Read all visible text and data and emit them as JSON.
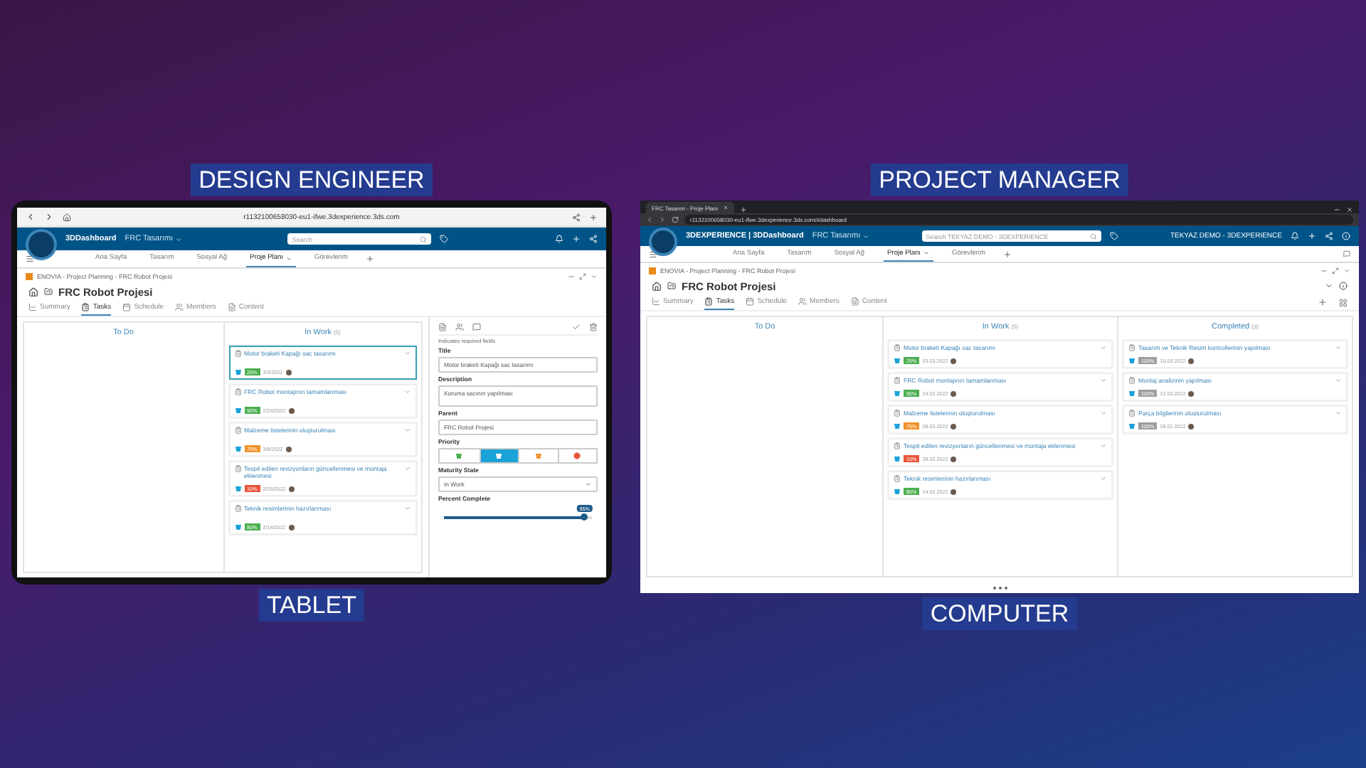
{
  "tablet": {
    "role_caption": "DESIGN ENGINEER",
    "device_caption": "TABLET",
    "url": "r1132100658030-eu1-ifwe.3dexperience.3ds.com",
    "app": {
      "brand": "3DDashboard",
      "dashboard": "FRC Tasarımı",
      "search_placeholder": "Search"
    },
    "tabs": [
      {
        "label": "Ana Sayfa",
        "selected": false
      },
      {
        "label": "Tasarım",
        "selected": false
      },
      {
        "label": "Sosyal Ağ",
        "selected": false
      },
      {
        "label": "Proje Planı",
        "selected": true
      },
      {
        "label": "Görevlerim",
        "selected": false
      }
    ],
    "breadcrumb": "ENOVIA - Project Planning - FRC Robot Projesi",
    "project": "FRC Robot Projesi",
    "views": [
      {
        "label": "Summary",
        "selected": false
      },
      {
        "label": "Tasks",
        "selected": true
      },
      {
        "label": "Schedule",
        "selected": false
      },
      {
        "label": "Members",
        "selected": false
      },
      {
        "label": "Content",
        "selected": false
      }
    ],
    "columns": [
      {
        "title": "To Do"
      },
      {
        "title": "In Work",
        "count": "(5)",
        "tasks": [
          {
            "title": "Motor braketi Kapağı sac tasarımı",
            "percent": "25%",
            "color": "#4caf50",
            "date": "3/3/2022",
            "selected": true
          },
          {
            "title": "FRC Robot montajının tamamlanması",
            "percent": "90%",
            "color": "#4caf50",
            "date": "2/24/2022",
            "selected": false
          },
          {
            "title": "Malzeme listelerinin oluşturulması",
            "percent": "75%",
            "color": "#f0932b",
            "date": "3/8/2022",
            "selected": false
          },
          {
            "title": "Tespit edilen revizyonların güncellenmesi ve montaja eklenmesi",
            "percent": "10%",
            "color": "#e8553b",
            "date": "2/25/2022",
            "selected": false
          },
          {
            "title": "Teknik resimlerinin hazırlanması",
            "percent": "80%",
            "color": "#4caf50",
            "date": "2/14/2022",
            "selected": false
          }
        ]
      }
    ],
    "detail": {
      "required_note": "Indicates required fields",
      "title_label": "Title",
      "title_value": "Motor braketi Kapağı sac tasarımı",
      "description_label": "Description",
      "description_value": "Koruma sacının yapılması",
      "parent_label": "Parent",
      "parent_value": "FRC Robot Projesi",
      "priority_label": "Priority",
      "priorities": [
        {
          "color": "#4caf50",
          "selected": false
        },
        {
          "color": "#ffffff",
          "selected": true
        },
        {
          "color": "#f0932b",
          "selected": false
        },
        {
          "color": "#e8553b",
          "selected": false
        }
      ],
      "maturity_label": "Maturity State",
      "maturity_value": "In Work",
      "percent_label": "Percent Complete",
      "percent_value": "95%",
      "level": 0.95
    }
  },
  "computer": {
    "role_caption": "PROJECT MANAGER",
    "device_caption": "COMPUTER",
    "browser_tab": "FRC Tasarım - Proje Planı",
    "url": "r1132100658030-eu1-ifwe.3dexperience.3ds.com/#dashboard",
    "app": {
      "brand": "3DEXPERIENCE | 3DDashboard",
      "dashboard": "FRC Tasarımı",
      "search_placeholder": "Search TEKYAZ DEMO - 3DEXPERIENCE",
      "account": "TEKYAZ DEMO - 3DEXPERIENCE"
    },
    "tabs": [
      {
        "label": "Ana Sayfa",
        "selected": false
      },
      {
        "label": "Tasarım",
        "selected": false
      },
      {
        "label": "Sosyal Ağ",
        "selected": false
      },
      {
        "label": "Proje Planı",
        "selected": true
      },
      {
        "label": "Görevlerim",
        "selected": false
      }
    ],
    "breadcrumb": "ENOVIA - Project Planning - FRC Robot Projesi",
    "project": "FRC Robot Projesi",
    "views": [
      {
        "label": "Summary",
        "selected": false
      },
      {
        "label": "Tasks",
        "selected": true
      },
      {
        "label": "Schedule",
        "selected": false
      },
      {
        "label": "Members",
        "selected": false
      },
      {
        "label": "Content",
        "selected": false
      }
    ],
    "columns": [
      {
        "title": "To Do"
      },
      {
        "title": "In Work",
        "count": "(5)",
        "tasks": [
          {
            "title": "Motor braketi Kapağı sac tasarımı",
            "percent": "25%",
            "color": "#4caf50",
            "date": "03.03.2022",
            "selected": false
          },
          {
            "title": "FRC Robot montajının tamamlanması",
            "percent": "90%",
            "color": "#4caf50",
            "date": "24.02.2022",
            "selected": false
          },
          {
            "title": "Malzeme listelerinin oluşturulması",
            "percent": "75%",
            "color": "#f0932b",
            "date": "08.03.2022",
            "selected": false
          },
          {
            "title": "Tespit edilen revizyonların güncellenmesi ve montaja eklenmesi",
            "percent": "10%",
            "color": "#e8553b",
            "date": "28.02.2022",
            "selected": false
          },
          {
            "title": "Teknik resimlerinin hazırlanması",
            "percent": "80%",
            "color": "#4caf50",
            "date": "14.02.2022",
            "selected": false
          }
        ]
      },
      {
        "title": "Completed",
        "count": "(3)",
        "tasks": [
          {
            "title": "Tasarım ve Teknik Resim kontrollerinin yapılması",
            "percent": "100%",
            "color": "#9e9e9e",
            "date": "10.03.2022",
            "selected": false
          },
          {
            "title": "Montaj analizinin yapılması",
            "percent": "100%",
            "color": "#9e9e9e",
            "date": "22.03.2022",
            "selected": false
          },
          {
            "title": "Parça bilgilerinin oluşturulması",
            "percent": "100%",
            "color": "#9e9e9e",
            "date": "28.01.2022",
            "selected": false
          }
        ]
      }
    ]
  }
}
